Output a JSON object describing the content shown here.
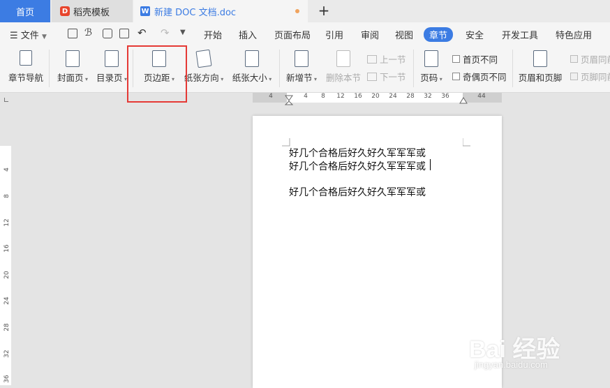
{
  "tabs": {
    "home": "首页",
    "daoke": "稻壳模板",
    "document": "新建 DOC 文档.doc",
    "new_tab": "+"
  },
  "menu": {
    "file": "文件",
    "items": [
      "开始",
      "插入",
      "页面布局",
      "引用",
      "审阅",
      "视图",
      "章节",
      "安全",
      "开发工具",
      "特色应用"
    ],
    "active": "章节"
  },
  "ribbon": {
    "nav": "章节导航",
    "cover": "封面页",
    "toc": "目录页",
    "margins": "页边距",
    "orientation": "纸张方向",
    "size": "纸张大小",
    "new_section": "新增节",
    "delete_section": "删除本节",
    "prev_section": "上一节",
    "next_section": "下一节",
    "page_number": "页码",
    "first_page_diff": "首页不同",
    "odd_even_diff": "奇偶页不同",
    "header_footer": "页眉和页脚",
    "header_same": "页眉同前",
    "footer_same": "页脚同前"
  },
  "ruler": {
    "horizontal": [
      "4",
      "4",
      "8",
      "12",
      "16",
      "20",
      "24",
      "28",
      "32",
      "36",
      "44"
    ],
    "vertical": [
      "4",
      "8",
      "12",
      "16",
      "20",
      "24",
      "28",
      "32",
      "36"
    ]
  },
  "document": {
    "lines": [
      "好几个合格后好久好久军军军或",
      "好几个合格后好久好久军军军或",
      "好几个合格后好久好久军军军或"
    ]
  },
  "watermark": {
    "main": "Bai 经验",
    "sub": "jingyan.baidu.com"
  },
  "colors": {
    "accent": "#3c7ce3",
    "highlight": "#e53935"
  }
}
